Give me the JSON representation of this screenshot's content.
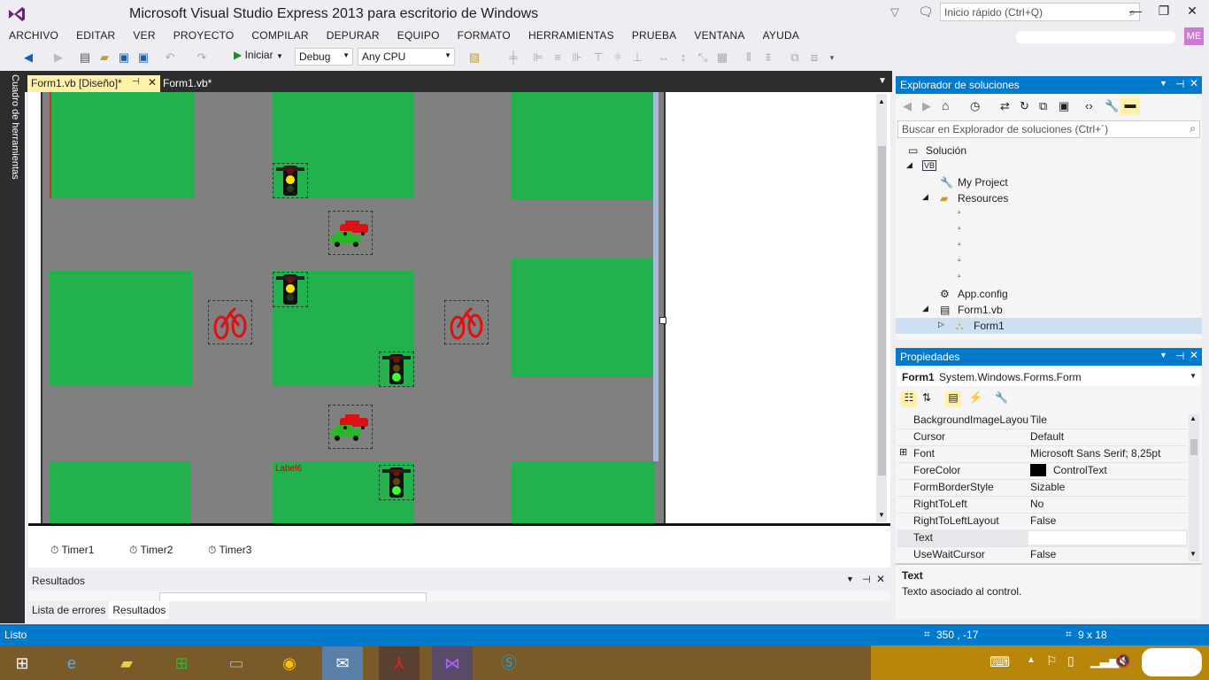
{
  "window": {
    "title": "Microsoft Visual Studio Express 2013 para escritorio de Windows",
    "quick_launch_placeholder": "Inicio rápido (Ctrl+Q)",
    "user_initials": "ME"
  },
  "menu": [
    "ARCHIVO",
    "EDITAR",
    "VER",
    "PROYECTO",
    "COMPILAR",
    "DEPURAR",
    "EQUIPO",
    "FORMATO",
    "HERRAMIENTAS",
    "PRUEBA",
    "VENTANA",
    "AYUDA"
  ],
  "toolbar": {
    "start_label": "Iniciar",
    "config_value": "Debug",
    "platform_value": "Any CPU"
  },
  "toolbox_label": "Cuadro de herramientas",
  "tabs": {
    "active": "Form1.vb [Diseño]*",
    "inactive": "Form1.vb*"
  },
  "designer": {
    "label6": "Label6"
  },
  "tray": {
    "timers": [
      "Timer1",
      "Timer2",
      "Timer3"
    ]
  },
  "results": {
    "title": "Resultados",
    "tabs": [
      "Lista de errores",
      "Resultados"
    ]
  },
  "solution_explorer": {
    "title": "Explorador de soluciones",
    "search_placeholder": "Buscar en Explorador de soluciones (Ctrl+´)",
    "items": {
      "solution": "Solución",
      "my_project": "My Project",
      "resources": "Resources",
      "app_config": "App.config",
      "form1_vb": "Form1.vb",
      "form1": "Form1"
    }
  },
  "properties": {
    "title": "Propiedades",
    "object_name": "Form1",
    "object_type": "System.Windows.Forms.Form",
    "rows": [
      {
        "name": "BackgroundImageLayou",
        "value": "Tile"
      },
      {
        "name": "Cursor",
        "value": "Default"
      },
      {
        "name": "Font",
        "value": "Microsoft Sans Serif; 8,25pt"
      },
      {
        "name": "ForeColor",
        "value": "ControlText"
      },
      {
        "name": "FormBorderStyle",
        "value": "Sizable"
      },
      {
        "name": "RightToLeft",
        "value": "No"
      },
      {
        "name": "RightToLeftLayout",
        "value": "False"
      },
      {
        "name": "Text",
        "value": ""
      },
      {
        "name": "UseWaitCursor",
        "value": "False"
      }
    ],
    "desc_title": "Text",
    "desc_text": "Texto asociado al control."
  },
  "status": {
    "text": "Listo",
    "position": "350 , -17",
    "size": "9 x 18"
  }
}
